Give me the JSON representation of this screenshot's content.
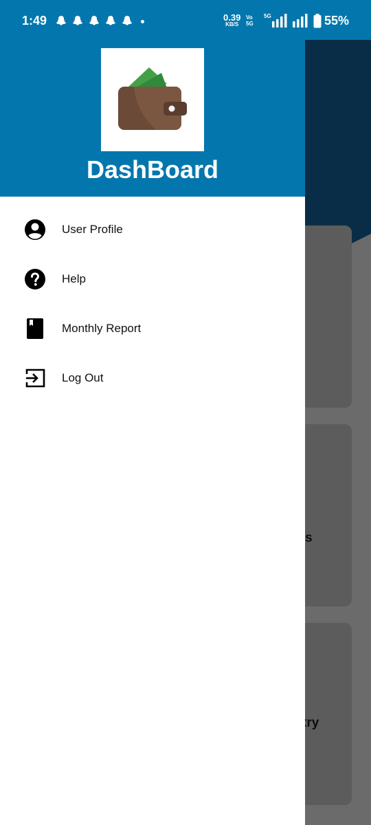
{
  "status_bar": {
    "time": "1:49",
    "net_speed": "0.39",
    "net_speed_unit": "KB/S",
    "volte_top": "Vo",
    "volte_bottom": "5G",
    "network_type": "5G",
    "battery": "55%",
    "notification_icons": [
      "snapchat-icon",
      "snapchat-icon",
      "snapchat-icon",
      "snapchat-icon",
      "snapchat-icon"
    ]
  },
  "drawer": {
    "title": "DashBoard",
    "logo": "wallet-icon",
    "items": [
      {
        "label": "User Profile",
        "icon": "account-circle-icon"
      },
      {
        "label": "Help",
        "icon": "help-circle-icon"
      },
      {
        "label": "Monthly Report",
        "icon": "book-icon"
      },
      {
        "label": "Log Out",
        "icon": "logout-icon"
      }
    ]
  },
  "background": {
    "card_texts": [
      "s",
      "try"
    ]
  },
  "colors": {
    "primary": "#0377ad",
    "drawer_bg": "#ffffff",
    "wallet_brown": "#6b4a38",
    "wallet_green": "#43a047"
  }
}
